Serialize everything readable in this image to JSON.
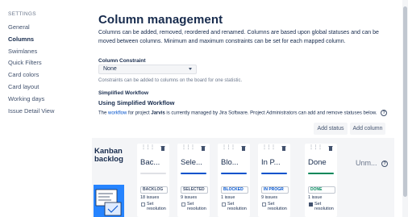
{
  "sidebar": {
    "heading": "SETTINGS",
    "items": [
      {
        "label": "General",
        "active": false
      },
      {
        "label": "Columns",
        "active": true
      },
      {
        "label": "Swimlanes",
        "active": false
      },
      {
        "label": "Quick Filters",
        "active": false
      },
      {
        "label": "Card colors",
        "active": false
      },
      {
        "label": "Card layout",
        "active": false
      },
      {
        "label": "Working days",
        "active": false
      },
      {
        "label": "Issue Detail View",
        "active": false
      }
    ]
  },
  "main": {
    "title": "Column management",
    "intro": "Columns can be added, removed, reordered and renamed. Columns are based upon global statuses and can be moved between columns. Minimum and maximum constraints can be set for each mapped column.",
    "constraint": {
      "label": "Column Constraint",
      "value": "None",
      "help": "Constraints can be added to columns on the board for one statistic."
    },
    "workflow": {
      "label": "Simplified Workflow",
      "title": "Using Simplified Workflow",
      "desc_prefix": "The ",
      "desc_link": "workflow",
      "desc_middle": " for project ",
      "desc_project": "Jarvis",
      "desc_suffix": " is currently managed by Jira Software. Project Administrators can add and remove statuses below.",
      "help_icon": "question-circle-icon"
    },
    "buttons": {
      "add_status": "Add status",
      "add_column": "Add column"
    }
  },
  "board": {
    "kanban_title_line1": "Kanban",
    "kanban_title_line2": "backlog",
    "columns": [
      {
        "name": "Bac...",
        "bar_color": "#dfe1e6",
        "status": "BACKLOG",
        "status_color": "#42526e",
        "issues": "18 issues",
        "res_line1": "Set",
        "res_line2": "resolution",
        "res_checked": false
      },
      {
        "name": "Sele...",
        "bar_color": "#0052cc",
        "status": "SELECTED",
        "status_color": "#42526e",
        "issues": "9 issues",
        "res_line1": "Set",
        "res_line2": "resolution",
        "res_checked": false
      },
      {
        "name": "Blo...",
        "bar_color": "#0052cc",
        "status": "BLOCKED",
        "status_color": "#0052cc",
        "issues": "1 issue",
        "res_line1": "Set",
        "res_line2": "resolution",
        "res_checked": false
      },
      {
        "name": "In P...",
        "bar_color": "#0052cc",
        "status": "IN PROGR",
        "status_color": "#0052cc",
        "issues": "9 issues",
        "res_line1": "Set",
        "res_line2": "resolution",
        "res_checked": false
      },
      {
        "name": "Done",
        "bar_color": "#00875a",
        "status": "DONE",
        "status_color": "#00875a",
        "issues": "1 issue",
        "res_line1": "Set",
        "res_line2": "resolution",
        "res_checked": true
      }
    ],
    "unmapped": "Unm...",
    "unmapped_icon": "question-circle-icon"
  },
  "colors": {
    "accent_blue": "#0052cc",
    "done_green": "#00875a",
    "art_blue": "#2684ff"
  }
}
